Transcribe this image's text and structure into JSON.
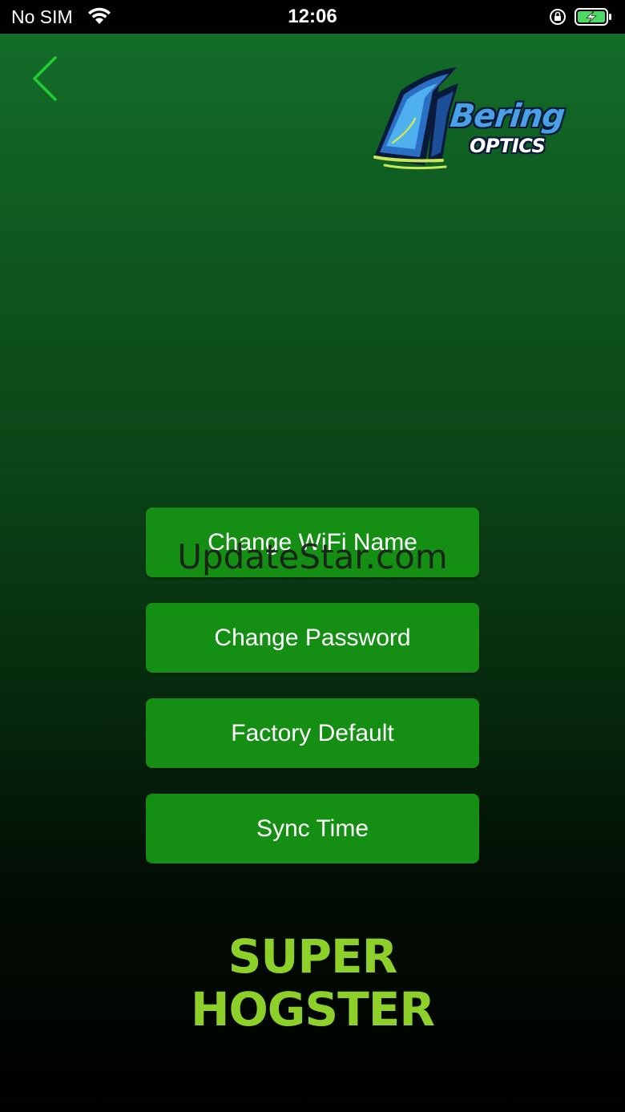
{
  "status_bar": {
    "carrier": "No SIM",
    "time": "12:06",
    "battery_color": "#4cd964"
  },
  "header": {
    "logo": {
      "line1": "Bering",
      "line2": "OPTICS"
    }
  },
  "menu": {
    "items": [
      {
        "label": "Change WiFi Name"
      },
      {
        "label": "Change Password"
      },
      {
        "label": "Factory Default"
      },
      {
        "label": "Sync Time"
      }
    ]
  },
  "watermark": "UpdateStar.com",
  "product": {
    "line1": "SUPER",
    "line2": "HOGSTER"
  },
  "colors": {
    "accent_green": "#148f14",
    "title_green": "#8ed02a",
    "back_green": "#22cc33"
  }
}
